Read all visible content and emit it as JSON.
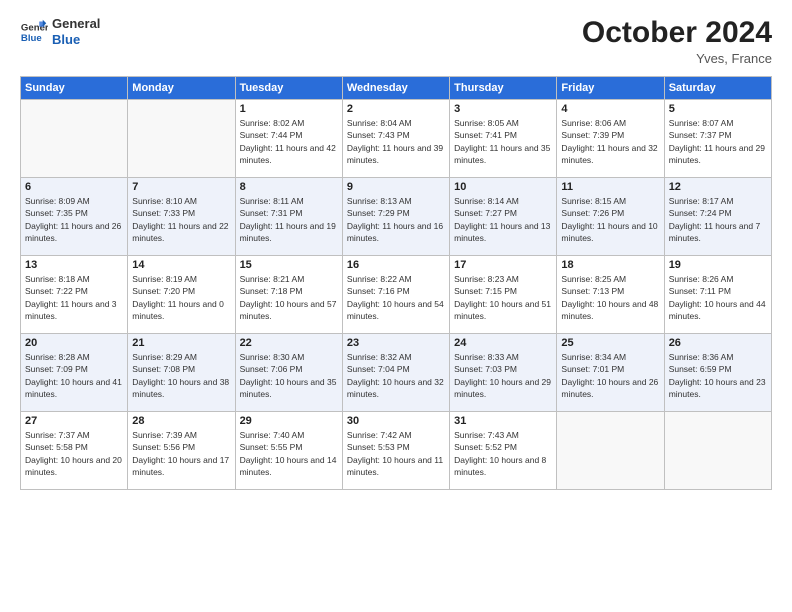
{
  "logo": {
    "line1": "General",
    "line2": "Blue"
  },
  "header": {
    "month": "October 2024",
    "location": "Yves, France"
  },
  "weekdays": [
    "Sunday",
    "Monday",
    "Tuesday",
    "Wednesday",
    "Thursday",
    "Friday",
    "Saturday"
  ],
  "weeks": [
    [
      {
        "day": "",
        "info": ""
      },
      {
        "day": "",
        "info": ""
      },
      {
        "day": "1",
        "info": "Sunrise: 8:02 AM\nSunset: 7:44 PM\nDaylight: 11 hours and 42 minutes."
      },
      {
        "day": "2",
        "info": "Sunrise: 8:04 AM\nSunset: 7:43 PM\nDaylight: 11 hours and 39 minutes."
      },
      {
        "day": "3",
        "info": "Sunrise: 8:05 AM\nSunset: 7:41 PM\nDaylight: 11 hours and 35 minutes."
      },
      {
        "day": "4",
        "info": "Sunrise: 8:06 AM\nSunset: 7:39 PM\nDaylight: 11 hours and 32 minutes."
      },
      {
        "day": "5",
        "info": "Sunrise: 8:07 AM\nSunset: 7:37 PM\nDaylight: 11 hours and 29 minutes."
      }
    ],
    [
      {
        "day": "6",
        "info": "Sunrise: 8:09 AM\nSunset: 7:35 PM\nDaylight: 11 hours and 26 minutes."
      },
      {
        "day": "7",
        "info": "Sunrise: 8:10 AM\nSunset: 7:33 PM\nDaylight: 11 hours and 22 minutes."
      },
      {
        "day": "8",
        "info": "Sunrise: 8:11 AM\nSunset: 7:31 PM\nDaylight: 11 hours and 19 minutes."
      },
      {
        "day": "9",
        "info": "Sunrise: 8:13 AM\nSunset: 7:29 PM\nDaylight: 11 hours and 16 minutes."
      },
      {
        "day": "10",
        "info": "Sunrise: 8:14 AM\nSunset: 7:27 PM\nDaylight: 11 hours and 13 minutes."
      },
      {
        "day": "11",
        "info": "Sunrise: 8:15 AM\nSunset: 7:26 PM\nDaylight: 11 hours and 10 minutes."
      },
      {
        "day": "12",
        "info": "Sunrise: 8:17 AM\nSunset: 7:24 PM\nDaylight: 11 hours and 7 minutes."
      }
    ],
    [
      {
        "day": "13",
        "info": "Sunrise: 8:18 AM\nSunset: 7:22 PM\nDaylight: 11 hours and 3 minutes."
      },
      {
        "day": "14",
        "info": "Sunrise: 8:19 AM\nSunset: 7:20 PM\nDaylight: 11 hours and 0 minutes."
      },
      {
        "day": "15",
        "info": "Sunrise: 8:21 AM\nSunset: 7:18 PM\nDaylight: 10 hours and 57 minutes."
      },
      {
        "day": "16",
        "info": "Sunrise: 8:22 AM\nSunset: 7:16 PM\nDaylight: 10 hours and 54 minutes."
      },
      {
        "day": "17",
        "info": "Sunrise: 8:23 AM\nSunset: 7:15 PM\nDaylight: 10 hours and 51 minutes."
      },
      {
        "day": "18",
        "info": "Sunrise: 8:25 AM\nSunset: 7:13 PM\nDaylight: 10 hours and 48 minutes."
      },
      {
        "day": "19",
        "info": "Sunrise: 8:26 AM\nSunset: 7:11 PM\nDaylight: 10 hours and 44 minutes."
      }
    ],
    [
      {
        "day": "20",
        "info": "Sunrise: 8:28 AM\nSunset: 7:09 PM\nDaylight: 10 hours and 41 minutes."
      },
      {
        "day": "21",
        "info": "Sunrise: 8:29 AM\nSunset: 7:08 PM\nDaylight: 10 hours and 38 minutes."
      },
      {
        "day": "22",
        "info": "Sunrise: 8:30 AM\nSunset: 7:06 PM\nDaylight: 10 hours and 35 minutes."
      },
      {
        "day": "23",
        "info": "Sunrise: 8:32 AM\nSunset: 7:04 PM\nDaylight: 10 hours and 32 minutes."
      },
      {
        "day": "24",
        "info": "Sunrise: 8:33 AM\nSunset: 7:03 PM\nDaylight: 10 hours and 29 minutes."
      },
      {
        "day": "25",
        "info": "Sunrise: 8:34 AM\nSunset: 7:01 PM\nDaylight: 10 hours and 26 minutes."
      },
      {
        "day": "26",
        "info": "Sunrise: 8:36 AM\nSunset: 6:59 PM\nDaylight: 10 hours and 23 minutes."
      }
    ],
    [
      {
        "day": "27",
        "info": "Sunrise: 7:37 AM\nSunset: 5:58 PM\nDaylight: 10 hours and 20 minutes."
      },
      {
        "day": "28",
        "info": "Sunrise: 7:39 AM\nSunset: 5:56 PM\nDaylight: 10 hours and 17 minutes."
      },
      {
        "day": "29",
        "info": "Sunrise: 7:40 AM\nSunset: 5:55 PM\nDaylight: 10 hours and 14 minutes."
      },
      {
        "day": "30",
        "info": "Sunrise: 7:42 AM\nSunset: 5:53 PM\nDaylight: 10 hours and 11 minutes."
      },
      {
        "day": "31",
        "info": "Sunrise: 7:43 AM\nSunset: 5:52 PM\nDaylight: 10 hours and 8 minutes."
      },
      {
        "day": "",
        "info": ""
      },
      {
        "day": "",
        "info": ""
      }
    ]
  ]
}
